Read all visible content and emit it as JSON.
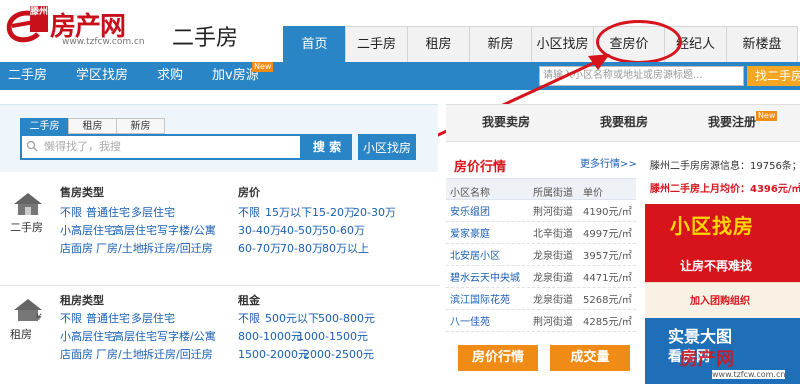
{
  "logo": {
    "brand": "房产网",
    "city_tag": "滕州",
    "url": "www.tzfcw.com.cn"
  },
  "section_title": "二手房",
  "nav": [
    "首页",
    "二手房",
    "租房",
    "新房",
    "小区找房",
    "查房价",
    "经纪人",
    "新楼盘"
  ],
  "subnav": {
    "items": [
      "二手房",
      "学区找房",
      "求购",
      "加v房源"
    ],
    "new_badge": "New",
    "search_placeholder": "请输入小区名称或地址或房源标题...",
    "search_button": "找二手房"
  },
  "search_panel": {
    "tabs": [
      "二手房",
      "租房",
      "新房"
    ],
    "placeholder": "懒得找了，我搜",
    "search_button": "搜 索",
    "area_button": "小区找房"
  },
  "sale": {
    "label": "二手房",
    "type_heading": "售房类型",
    "type_rows": [
      [
        "不限",
        "普通住宅",
        "多层住宅"
      ],
      [
        "小高层住宅",
        "高层住宅",
        "写字楼/公寓"
      ],
      [
        "店面房",
        "厂房/土地",
        "拆迁房/回迁房"
      ]
    ],
    "price_heading": "房价",
    "price_rows": [
      [
        "不限",
        "15万以下",
        "15-20万",
        "20-30万"
      ],
      [
        "30-40万",
        "40-50万",
        "50-60万"
      ],
      [
        "60-70万",
        "70-80万",
        "80万以上"
      ]
    ]
  },
  "rent": {
    "label": "租房",
    "type_heading": "租房类型",
    "type_rows": [
      [
        "不限",
        "普通住宅",
        "多层住宅"
      ],
      [
        "小高层住宅",
        "高层住宅",
        "写字楼/公寓"
      ],
      [
        "店面房",
        "厂房/土地",
        "拆迁房/回迁房"
      ]
    ],
    "price_heading": "租金",
    "price_rows": [
      [
        "不限",
        "500元以下",
        "500-800元"
      ],
      [
        "800-1000元",
        "1000-1500元"
      ],
      [
        "1500-2000元",
        "2000-2500元"
      ]
    ]
  },
  "right_tabs": [
    "我要卖房",
    "我要租房",
    "我要注册"
  ],
  "right_new_badge": "New",
  "price_panel": {
    "title": "房价行情",
    "more": "更多行情>>",
    "headers": [
      "小区名称",
      "所属街道",
      "单价"
    ],
    "rows": [
      [
        "安乐缊团",
        "荆河街道",
        "4190元/㎡"
      ],
      [
        "爱家豪庭",
        "北辛街道",
        "4997元/㎡"
      ],
      [
        "北安居小区",
        "龙泉街道",
        "3957元/㎡"
      ],
      [
        "碧水云天中央城",
        "龙泉街道",
        "4471元/㎡"
      ],
      [
        "滨江国际花苑",
        "龙泉街道",
        "5268元/㎡"
      ],
      [
        "八一佳苑",
        "荆河街道",
        "4285元/㎡"
      ]
    ],
    "btn_price": "房价行情",
    "btn_deal": "成交量"
  },
  "stats": {
    "line1": "滕州二手房房源信息：19756条；",
    "line2_label": "滕州二手房上月均价：",
    "line2_value": "4396元/㎡"
  },
  "ads": {
    "ad1_title": "小区找房",
    "ad1_sub": "让房不再难找",
    "ad2_title": "加入团购组织",
    "ad3_title": "实景大图",
    "ad3_sub": "看房网"
  },
  "watermark": {
    "text": "房产网",
    "url": "www.tzfcw.com.cn"
  },
  "colors": {
    "brand_red": "#c8101b",
    "nav_blue": "#2a85c6",
    "accent_orange": "#f08b16"
  }
}
